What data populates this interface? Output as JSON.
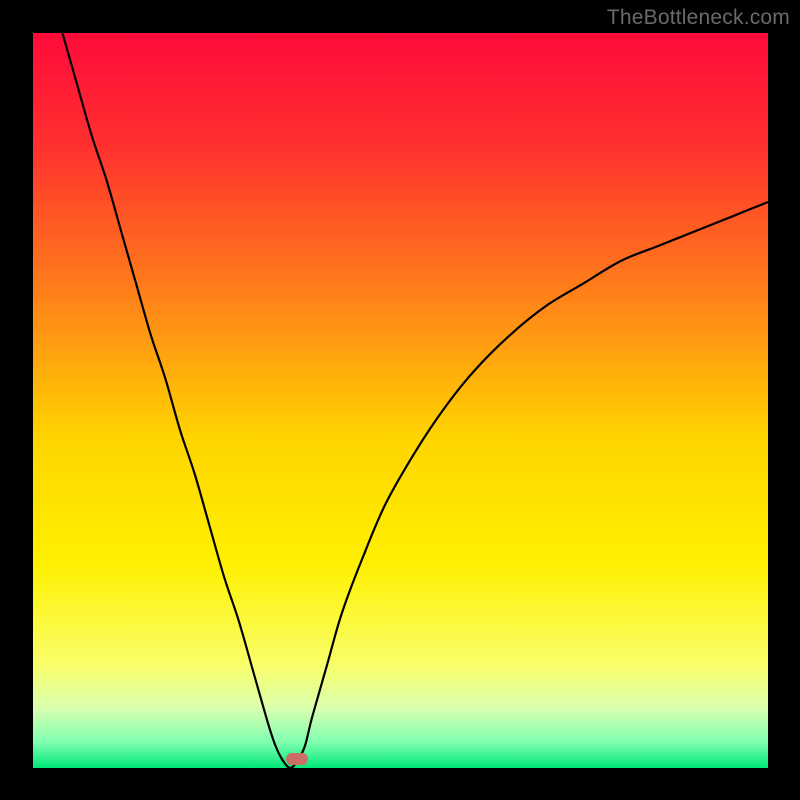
{
  "watermark": "TheBottleneck.com",
  "chart_data": {
    "type": "line",
    "title": "",
    "xlabel": "",
    "ylabel": "",
    "xlim": [
      0,
      100
    ],
    "ylim": [
      0,
      100
    ],
    "gradient_stops": [
      {
        "pos": 0.0,
        "color": "#ff0b3a"
      },
      {
        "pos": 0.15,
        "color": "#ff2f2f"
      },
      {
        "pos": 0.35,
        "color": "#ff7e1a"
      },
      {
        "pos": 0.55,
        "color": "#ffd400"
      },
      {
        "pos": 0.72,
        "color": "#fff000"
      },
      {
        "pos": 0.86,
        "color": "#f9ff6a"
      },
      {
        "pos": 0.92,
        "color": "#d8ffb0"
      },
      {
        "pos": 0.965,
        "color": "#7fffb0"
      },
      {
        "pos": 1.0,
        "color": "#00e878"
      }
    ],
    "series": [
      {
        "name": "bottleneck-curve",
        "x": [
          4,
          6,
          8,
          10,
          12,
          14,
          16,
          18,
          20,
          22,
          24,
          26,
          28,
          30,
          32,
          33,
          34,
          35,
          36,
          37,
          38,
          40,
          42,
          45,
          48,
          52,
          56,
          60,
          65,
          70,
          75,
          80,
          85,
          90,
          95,
          100
        ],
        "y": [
          100,
          93,
          86,
          80,
          73,
          66,
          59,
          53,
          46,
          40,
          33,
          26,
          20,
          13,
          6,
          3,
          1,
          0,
          1,
          3,
          7,
          14,
          21,
          29,
          36,
          43,
          49,
          54,
          59,
          63,
          66,
          69,
          71,
          73,
          75,
          77
        ]
      }
    ],
    "marker": {
      "x": 35,
      "y": 0,
      "color": "#cb6e66"
    }
  }
}
